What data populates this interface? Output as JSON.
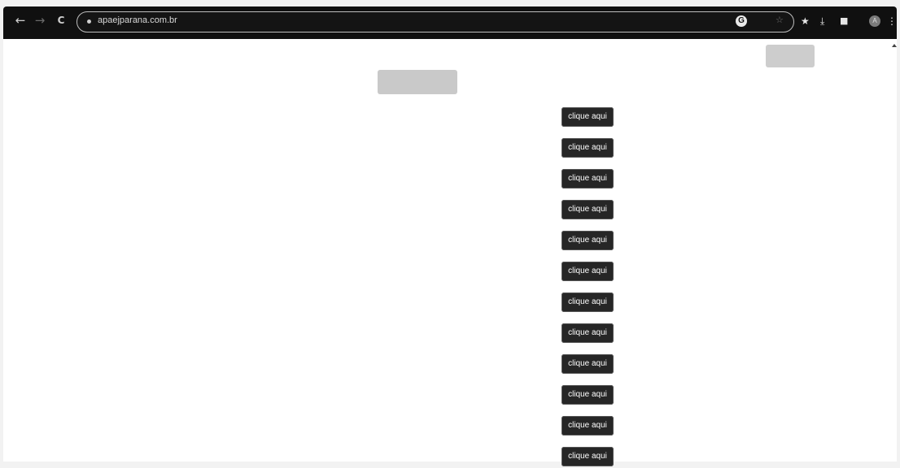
{
  "browser": {
    "url": "apaejparana.com.br",
    "icons": {
      "back": "arrow-left-icon",
      "forward": "arrow-right-icon",
      "reload": "reload-icon",
      "google": "google-icon",
      "bookmark": "star-icon",
      "extensions": "pin-icon",
      "download": "download-icon",
      "sidepanel": "sidepanel-icon",
      "profile": "profile-icon",
      "menu": "kebab-menu-icon"
    },
    "glyphs": {
      "back": "←",
      "forward": "→",
      "reload": "C",
      "google": "G",
      "bookmark": "☆",
      "extensions": "★",
      "download": "⤓",
      "sidepanel": "■",
      "profile": "A",
      "menu": "⋮"
    }
  },
  "page": {
    "rows": [
      {
        "label": "",
        "button": "clique aqui"
      },
      {
        "label": "",
        "button": "clique aqui"
      },
      {
        "label": "",
        "button": "clique aqui"
      },
      {
        "label": "",
        "button": "clique aqui"
      },
      {
        "label": "",
        "button": "clique aqui"
      },
      {
        "label": "",
        "button": "clique aqui"
      },
      {
        "label": "",
        "button": "clique aqui"
      },
      {
        "label": "",
        "button": "clique aqui"
      },
      {
        "label": "",
        "button": "clique aqui"
      },
      {
        "label": "",
        "button": "clique aqui"
      },
      {
        "label": "",
        "button": "clique aqui"
      },
      {
        "label": "",
        "button": "clique aqui"
      }
    ]
  },
  "colors": {
    "topbar": "#101010",
    "row_button": "#262626",
    "faded_button": "#c9c9c9"
  }
}
